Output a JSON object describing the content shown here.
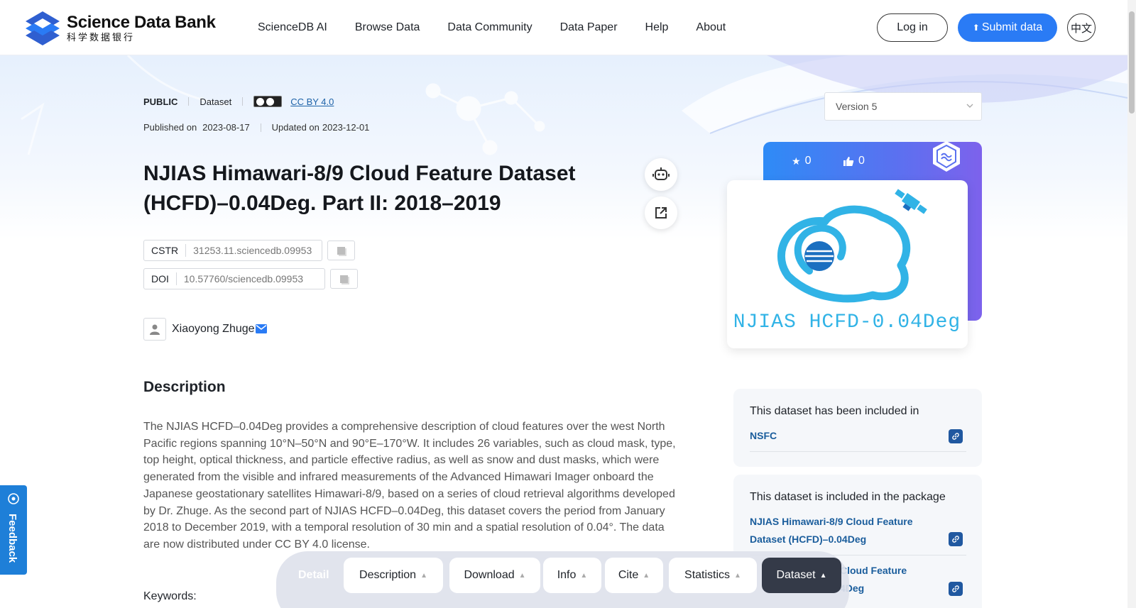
{
  "header": {
    "logo_en": "Science Data Bank",
    "logo_cn": "科学数据银行",
    "nav": [
      "ScienceDB AI",
      "Browse Data",
      "Data Community",
      "Data Paper",
      "Help",
      "About"
    ],
    "login_label": "Log in",
    "submit_label": "Submit data",
    "lang_label": "中文",
    "accent_color": "#2a7bf5"
  },
  "meta": {
    "access": "PUBLIC",
    "type": "Dataset",
    "license": "CC BY 4.0",
    "published_label": "Published on",
    "published_date": "2023-08-17",
    "updated_label": "Updated on",
    "updated_date": "2023-12-01"
  },
  "title": "NJIAS Himawari-8/9 Cloud Feature Dataset (HCFD)–0.04Deg. Part II: 2018–2019",
  "identifiers": {
    "cstr_label": "CSTR",
    "cstr_value": "31253.11.sciencedb.09953",
    "doi_label": "DOI",
    "doi_value": "10.57760/sciencedb.09953"
  },
  "author": {
    "name": "Xiaoyong Zhuge"
  },
  "description": {
    "heading": "Description",
    "text": "The NJIAS HCFD–0.04Deg provides a comprehensive description of cloud features over the west North Pacific regions spanning 10°N–50°N and 90°E–170°W. It includes 26 variables, such as cloud mask, type, top height, optical thickness, and particle effective radius, as well as snow and dust masks, which were generated from the visible and infrared measurements of the Advanced Himawari Imager onboard the Japanese geostationary satellites Himawari-8/9, based on a series of cloud retrieval algorithms developed by Dr. Zhuge. As the second part of NJIAS HCFD–0.04Deg, this dataset covers the period from January 2018 to December 2019, with a temporal resolution of 30 min and a spatial resolution of 0.04°. The data are now distributed under CC BY 4.0 license.",
    "keywords_label": "Keywords:"
  },
  "sidebar": {
    "version": "Version 5",
    "stars": "0",
    "likes": "0",
    "cover_text": "NJIAS HCFD-0.04Deg",
    "included_in_title": "This dataset has been included in",
    "included_in_link": "NSFC",
    "package_title": "This dataset is included in the package",
    "package_links": [
      "NJIAS Himawari-8/9 Cloud Feature Dataset (HCFD)–0.04Deg",
      "Cloud Feature\n4Deg"
    ]
  },
  "feedback_label": "Feedback",
  "tabbar": {
    "detail": "Detail",
    "tabs": [
      "Description",
      "Download",
      "Info",
      "Cite",
      "Statistics",
      "Dataset"
    ]
  }
}
